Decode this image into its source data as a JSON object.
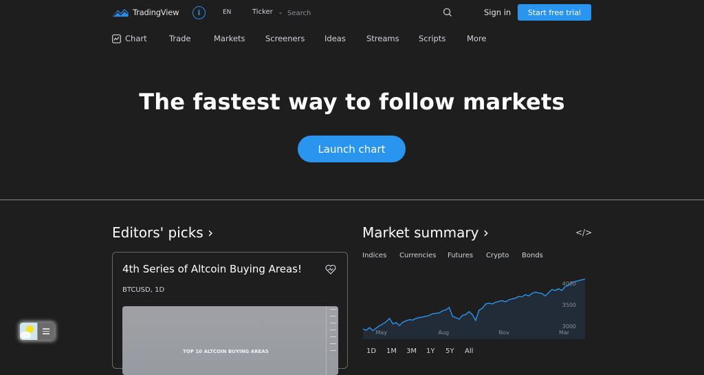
{
  "header": {
    "brand": "TradingView",
    "language": "EN",
    "ticker_label": "Ticker",
    "search_placeholder": "Search",
    "sign_in": "Sign in",
    "cta": "Start free trial"
  },
  "nav": {
    "items": [
      {
        "label": "Chart",
        "icon": "chart-icon"
      },
      {
        "label": "Trade"
      },
      {
        "label": "Markets"
      },
      {
        "label": "Screeners"
      },
      {
        "label": "Ideas"
      },
      {
        "label": "Streams"
      },
      {
        "label": "Scripts"
      },
      {
        "label": "More"
      }
    ]
  },
  "hero": {
    "title": "The fastest way to follow markets",
    "button": "Launch chart"
  },
  "editors_picks": {
    "title": "Editors' picks ›",
    "card": {
      "title": "4th Series of Altcoin Buying Areas!",
      "subtitle": "BTCUSD, 1D",
      "image_label": "TOP 10 ALTCOIN BUYING AREAS",
      "icon": "boost-heart-icon"
    }
  },
  "market_summary": {
    "title": "Market summary ›",
    "embed_icon": "</>",
    "tabs": [
      "Indices",
      "Currencies",
      "Futures",
      "Crypto",
      "Bonds"
    ],
    "ranges": [
      "1D",
      "1M",
      "3M",
      "1Y",
      "5Y",
      "All"
    ],
    "chart": {
      "y_ticks": [
        3000,
        3500,
        4000
      ],
      "x_ticks": [
        "May",
        "Aug",
        "Nov",
        "Mar"
      ],
      "line_color": "#2a95ee",
      "area_color": "#222b38",
      "approx_series": [
        2930,
        2900,
        2960,
        2890,
        2950,
        3010,
        3050,
        3100,
        3180,
        3050,
        3080,
        3010,
        3090,
        3120,
        3150,
        3140,
        3180,
        3200,
        3210,
        3230,
        3250,
        3290,
        3300,
        3310,
        3360,
        3380,
        3440,
        3230,
        3200,
        3160,
        3250,
        3270,
        3340,
        3270,
        3130,
        3370,
        3420,
        3520,
        3540,
        3520,
        3560,
        3580,
        3600,
        3570,
        3620,
        3640,
        3660,
        3700,
        3690,
        3740,
        3710,
        3770,
        3800,
        3780,
        3770,
        3710,
        3790,
        3860,
        3840,
        3880,
        3840,
        3930,
        3960,
        4030,
        4050,
        4070,
        4090,
        4110
      ]
    }
  },
  "theme_toggle": {
    "state": "light"
  }
}
